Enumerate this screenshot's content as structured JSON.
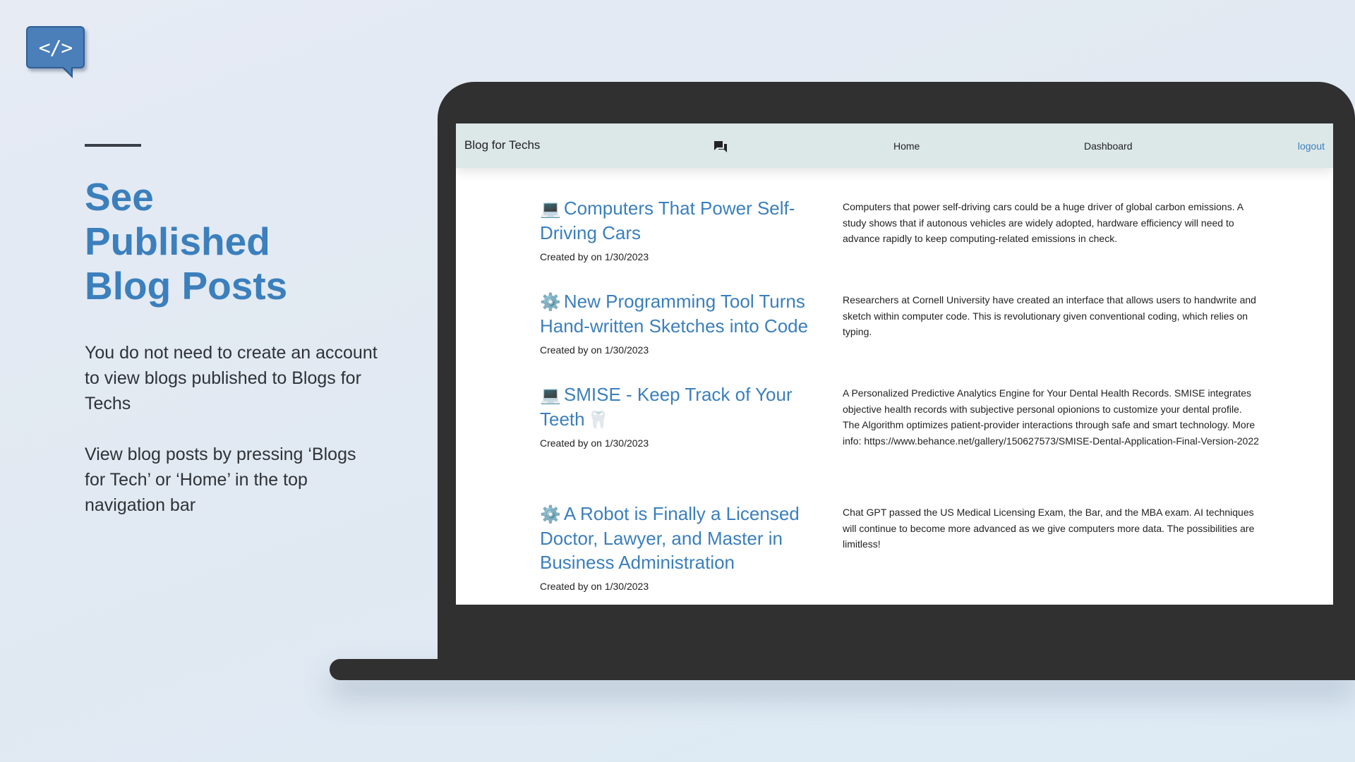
{
  "logo": {
    "glyph": "</>",
    "icon": "code-chat-bubble-icon"
  },
  "hero": {
    "title_lines": [
      "See",
      "Published",
      "Blog Posts"
    ],
    "paragraph_1": "You do not need to create an account to view blogs published to Blogs for Techs",
    "paragraph_2": "View blog posts by pressing ‘Blogs for Tech’ or ‘Home’ in the top navigation bar"
  },
  "navbar": {
    "brand": "Blog for Techs",
    "icon": "chat-icon",
    "home": "Home",
    "dashboard": "Dashboard",
    "logout": "logout"
  },
  "posts": [
    {
      "emoji": "💻",
      "title": "Computers That Power Self-Driving Cars",
      "trailing_emoji": "",
      "meta": "Created by on 1/30/2023",
      "description": "Computers that power self-driving cars could be a huge driver of global carbon emissions. A study shows that if autonous vehicles are widely adopted, hardware efficiency will need to advance rapidly to keep computing-related emissions in check."
    },
    {
      "emoji": "⚙️",
      "title": "New Programming Tool Turns Hand-written Sketches into Code",
      "trailing_emoji": "",
      "meta": "Created by on 1/30/2023",
      "description": "Researchers at Cornell University have created an interface that allows users to handwrite and sketch within computer code. This is revolutionary given conventional coding, which relies on typing."
    },
    {
      "emoji": "💻",
      "title": "SMISE - Keep Track of Your Teeth",
      "trailing_emoji": "🦷",
      "meta": "Created by on 1/30/2023",
      "description": "A Personalized Predictive Analytics Engine for Your Dental Health Records. SMISE integrates objective health records with subjective personal opionions to customize your dental profile. The Algorithm optimizes patient-provider interactions through safe and smart technology. More info: https://www.behance.net/gallery/150627573/SMISE-Dental-Application-Final-Version-2022"
    },
    {
      "emoji": "⚙️",
      "title": "A Robot is Finally a Licensed Doctor, Lawyer, and Master in Business Administration",
      "trailing_emoji": "",
      "meta": "Created by on 1/30/2023",
      "description": "Chat GPT passed the US Medical Licensing Exam, the Bar, and the MBA exam. AI techniques will continue to become more advanced as we give computers more data. The possibilities are limitless!"
    }
  ]
}
